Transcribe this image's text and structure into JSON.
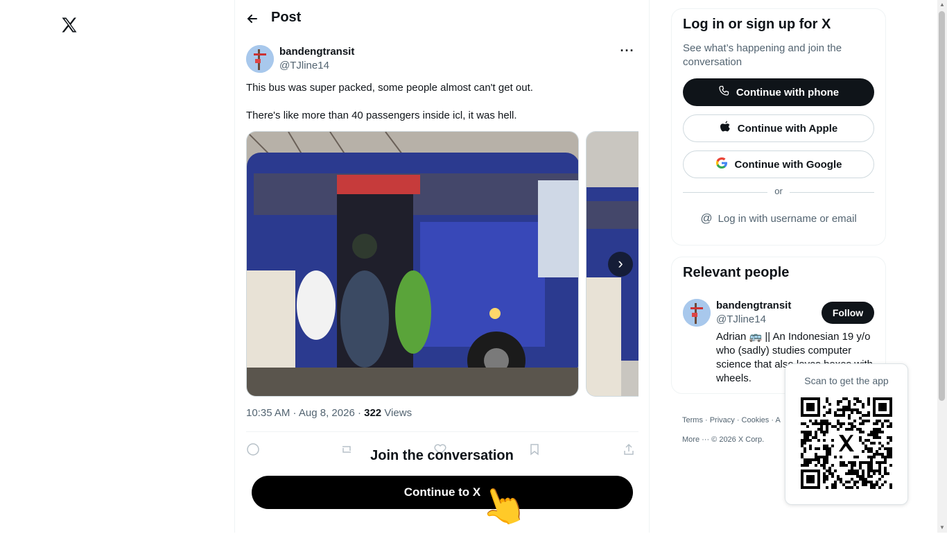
{
  "header": {
    "logo_icon": "x-logo-icon",
    "title": "Post",
    "back_icon": "arrow-left-icon"
  },
  "post": {
    "author_name": "bandengtransit",
    "author_handle": "@TJline14",
    "more_label": "···",
    "text_line1": "This bus was super packed, some people almost can't get out.",
    "text_line2": "There's like more than 40 passengers inside icl, it was hell.",
    "time": "10:35 AM · Aug 8, 2026 · ",
    "views_count": "322",
    "views_label": " Views",
    "next_label": "›",
    "join_title": "Join the conversation",
    "continue_label": "Continue to X",
    "pointer_emoji": "👆"
  },
  "login": {
    "title": "Log in or sign up for X",
    "subtitle": "See what’s happening and join the conversation",
    "phone_label": "Continue with phone",
    "apple_label": "Continue with Apple",
    "google_label": "Continue with Google",
    "or_label": "or",
    "username_label": "Log in with username or email",
    "at_symbol": "@"
  },
  "relevant": {
    "title": "Relevant people",
    "name": "bandengtransit",
    "handle": "@TJline14",
    "follow_label": "Follow",
    "bio": "Adrian 🚌 || An Indonesian 19 y/o who (sadly) studies computer science that also loves boxes with wheels."
  },
  "footer": {
    "line1": "Terms · Privacy · Cookies · A",
    "line2": "More ··· © 2026 X Corp."
  },
  "qr": {
    "label": "Scan to get the app"
  },
  "colors": {
    "primary_text": "#0f1419",
    "secondary_text": "#536471",
    "border": "#eff3f4",
    "button_dark": "#0f1419"
  }
}
